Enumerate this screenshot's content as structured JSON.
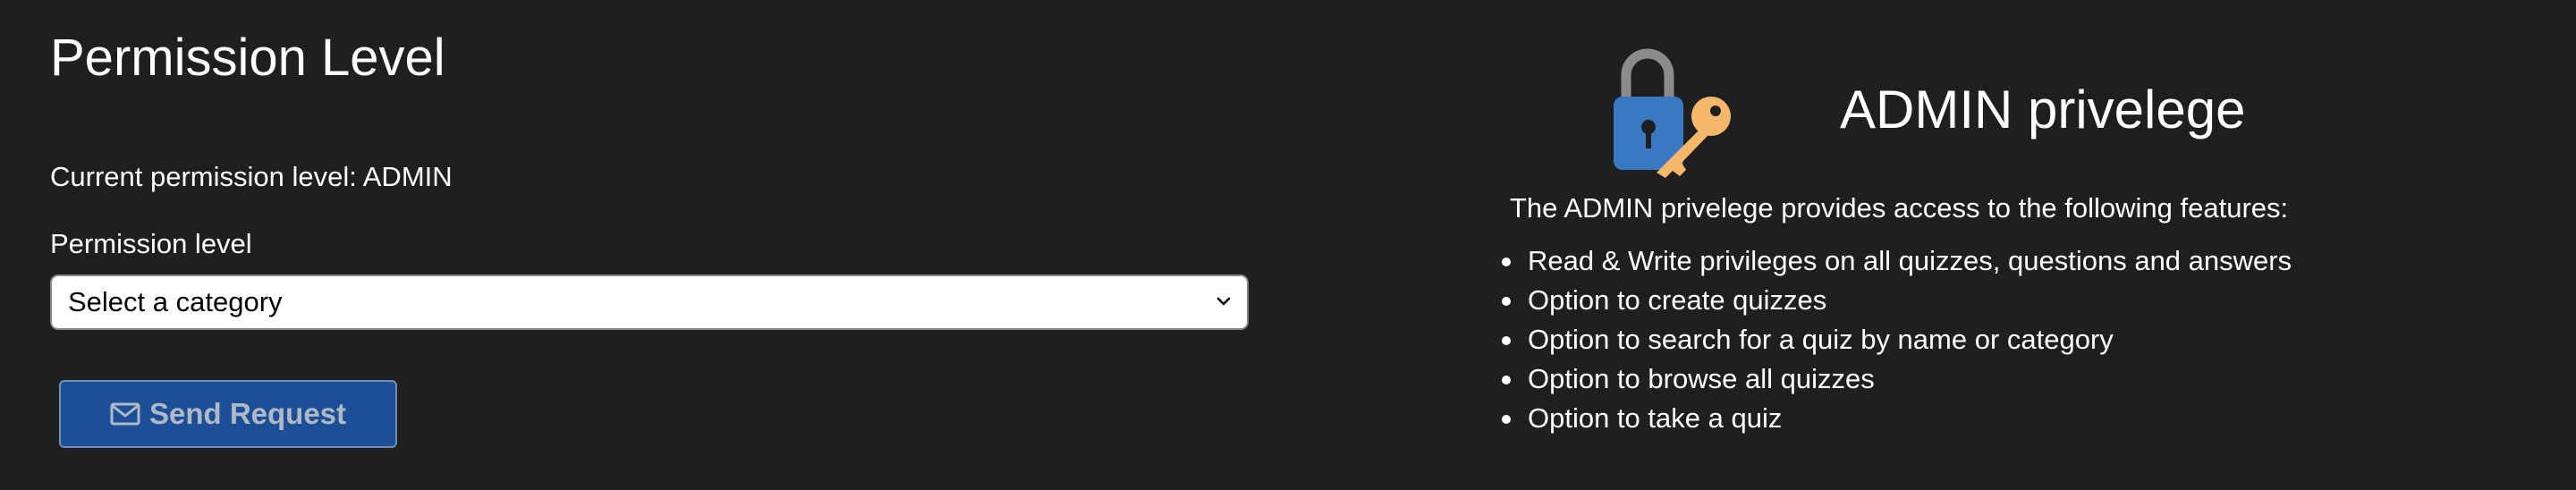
{
  "left_panel": {
    "title": "Permission Level",
    "current_level_text": "Current permission level: ADMIN",
    "field_label": "Permission level",
    "select": {
      "selected": "Select a category"
    },
    "send_button": {
      "label": "Send Request",
      "icon": "envelope-icon"
    }
  },
  "right_panel": {
    "icon": "lock-key-icon",
    "title": "ADMIN privelege",
    "intro": "The ADMIN privelege provides access to the following features:",
    "features": [
      "Read & Write privileges on all quizzes, questions and answers",
      "Option to create quizzes",
      "Option to search for a quiz by name or category",
      "Option to browse all quizzes",
      "Option to take a quiz"
    ]
  },
  "colors": {
    "background": "#1f1f1f",
    "text": "#ffffff",
    "button": "#1c4f96",
    "lock": "#3a78c2",
    "key": "#f5b86a",
    "shackle": "#8c8c8c"
  }
}
